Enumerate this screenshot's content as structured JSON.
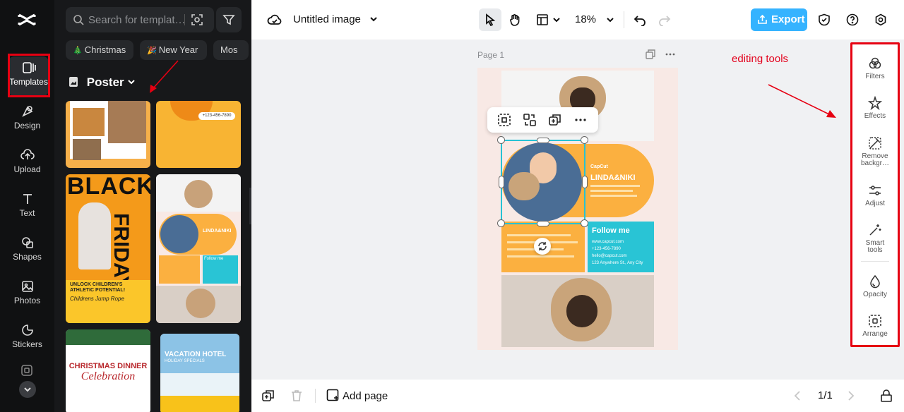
{
  "sidebar": {
    "logo": "capcut-logo",
    "items": [
      {
        "label": "Templates",
        "icon": "templates-icon"
      },
      {
        "label": "Design",
        "icon": "design-icon"
      },
      {
        "label": "Upload",
        "icon": "upload-icon"
      },
      {
        "label": "Text",
        "icon": "text-icon"
      },
      {
        "label": "Shapes",
        "icon": "shapes-icon"
      },
      {
        "label": "Photos",
        "icon": "photos-icon"
      },
      {
        "label": "Stickers",
        "icon": "stickers-icon"
      }
    ]
  },
  "panel": {
    "search_placeholder": "Search for templat…",
    "chips": [
      "Christmas",
      "New Year",
      "Mos"
    ],
    "category": "Poster",
    "thumbnails": {
      "black_friday": {
        "line1": "BLACK",
        "line2": "FRIDAY",
        "tagline": "UNLOCK CHILDREN'S ATHLETIC POTENTIAL!",
        "sub": "Childrens Jump Rope"
      },
      "pug": {
        "name": "LINDA&NIKI",
        "follow": "Follow me"
      },
      "christmas": {
        "title": "CHRISTMAS DINNER",
        "script": "Celebration"
      },
      "vacation": {
        "title": "VACATION HOTEL",
        "sub": "HOLIDAY SPECIALS"
      },
      "phone": "+123-456-7890"
    }
  },
  "topbar": {
    "title": "Untitled image",
    "zoom": "18%",
    "export_label": "Export"
  },
  "canvas": {
    "page_label": "Page 1",
    "annotation": "editing tools",
    "poster": {
      "brand": "CapCut",
      "name": "LINDA&NIKI",
      "follow": "Follow me",
      "contacts": [
        "www.capcut.com",
        "+123-456-7890",
        "hello@capcut.com",
        "123 Anywhere St., Any City"
      ]
    }
  },
  "tools": [
    {
      "label": "Filters",
      "icon": "filters-icon"
    },
    {
      "label": "Effects",
      "icon": "effects-icon"
    },
    {
      "label": "Remove backgr…",
      "icon": "remove-background-icon"
    },
    {
      "label": "Adjust",
      "icon": "adjust-icon"
    },
    {
      "label": "Smart tools",
      "icon": "smart-tools-icon"
    },
    {
      "label": "Opacity",
      "icon": "opacity-icon"
    },
    {
      "label": "Arrange",
      "icon": "arrange-icon"
    }
  ],
  "bottombar": {
    "add_page": "Add page",
    "page_count": "1/1"
  },
  "colors": {
    "accent": "#35b3ff",
    "annotation_red": "#e60012",
    "poster_orange": "#fbb040",
    "poster_teal": "#29c4d5"
  }
}
